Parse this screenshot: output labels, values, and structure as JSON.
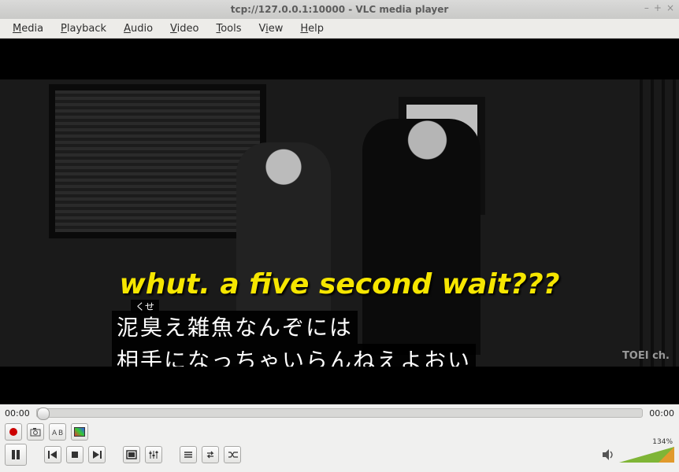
{
  "window": {
    "title": "tcp://127.0.0.1:10000 - VLC media player",
    "controls": {
      "minimize": "–",
      "maximize": "+",
      "close": "×"
    }
  },
  "menu": {
    "media": {
      "accel": "M",
      "rest": "edia"
    },
    "playback": {
      "accel": "P",
      "rest": "layback"
    },
    "audio": {
      "accel": "A",
      "rest": "udio"
    },
    "video": {
      "accel": "V",
      "rest": "ideo"
    },
    "tools": {
      "accel": "T",
      "rest": "ools"
    },
    "view": {
      "accel": "V",
      "rest": "iew",
      "label_full": "View"
    },
    "help": {
      "accel": "H",
      "rest": "elp"
    }
  },
  "video": {
    "overlay_text": "whut. a five second wait???",
    "furigana": "くせ",
    "sub_line1": "泥臭え雑魚なんぞには",
    "sub_line2": "相手になっちゃいらんねえよおい",
    "watermark": "TOEI ch."
  },
  "seek": {
    "elapsed": "00:00",
    "remaining": "00:00",
    "position_pct": 0
  },
  "toolbar1": {
    "record": "record-button",
    "snapshot": "snapshot-button",
    "atob": "a-to-b-loop-button",
    "tvcard": "tv-card-button"
  },
  "toolbar2": {
    "play": "play-pause-button",
    "prev": "previous-button",
    "stop": "stop-button",
    "next": "next-button",
    "fullscreen": "fullscreen-button",
    "ext": "extended-settings-button",
    "playlist": "playlist-button",
    "loop": "loop-button",
    "shuffle": "shuffle-button"
  },
  "volume": {
    "percent_label": "134%",
    "muted": false
  }
}
